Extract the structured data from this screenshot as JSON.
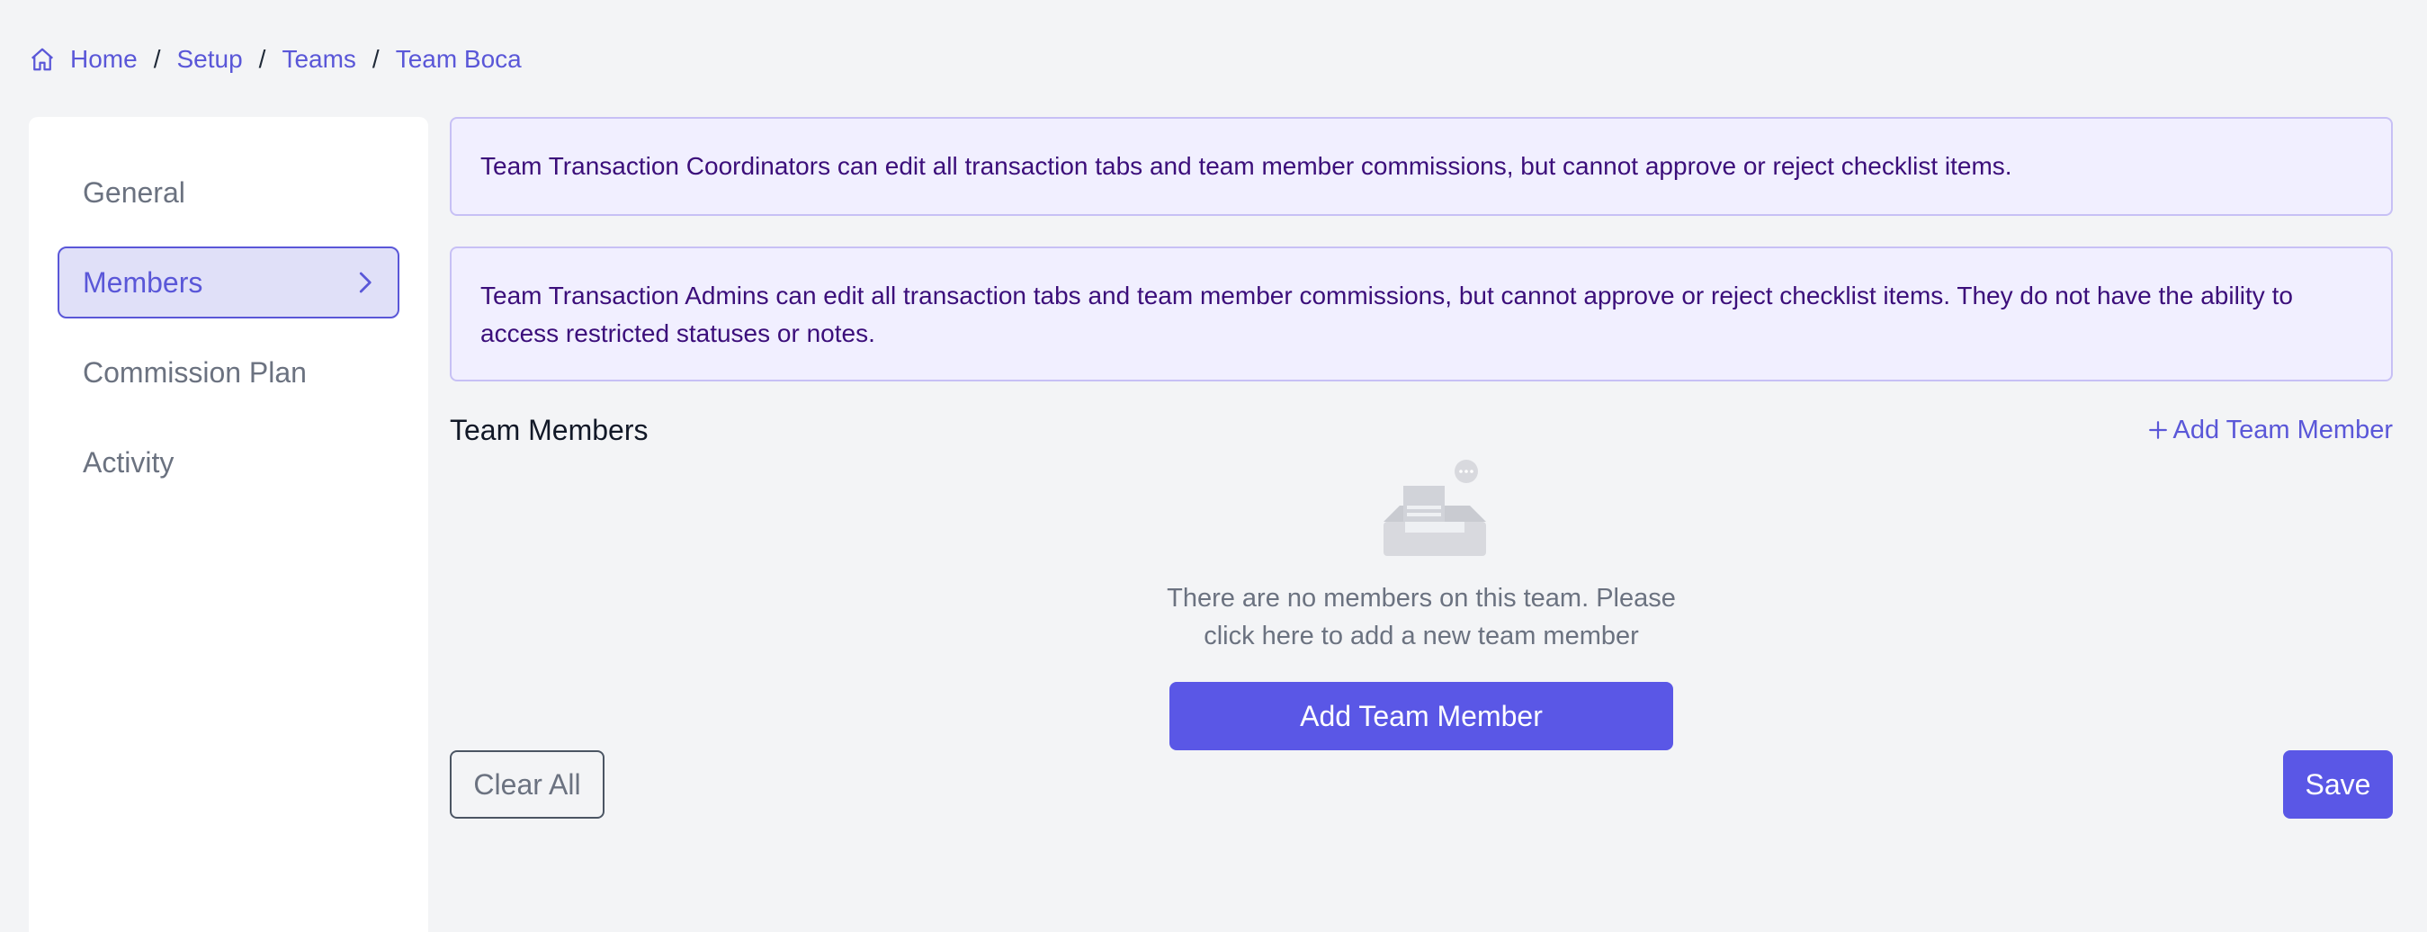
{
  "breadcrumb": {
    "icon": "home-icon",
    "items": [
      "Home",
      "Setup",
      "Teams",
      "Team Boca"
    ],
    "separator": "/"
  },
  "sidebar": {
    "items": [
      {
        "label": "General",
        "active": false
      },
      {
        "label": "Members",
        "active": true,
        "icon": "chevron-right-icon"
      },
      {
        "label": "Commission Plan",
        "active": false
      },
      {
        "label": "Activity",
        "active": false
      }
    ]
  },
  "notices": {
    "coordinators": "Team Transaction Coordinators can edit all transaction tabs and team member commissions, but cannot approve or reject checklist items.",
    "admins": "Team Transaction Admins can edit all transaction tabs and team member commissions, but cannot approve or reject checklist items. They do not have the ability to access restricted statuses or notes."
  },
  "members": {
    "title": "Team Members",
    "add_link": "Add Team Member",
    "empty_icon": "empty-inbox-icon",
    "empty_text": "There are no members on this team. Please click here to add a new team member",
    "add_button": "Add Team Member"
  },
  "footer": {
    "clear_label": "Clear All",
    "save_label": "Save"
  },
  "colors": {
    "accent": "#5a57e6",
    "background": "#f3f4f6",
    "notice_bg": "#f1efff",
    "notice_text": "#3b0e7a"
  }
}
